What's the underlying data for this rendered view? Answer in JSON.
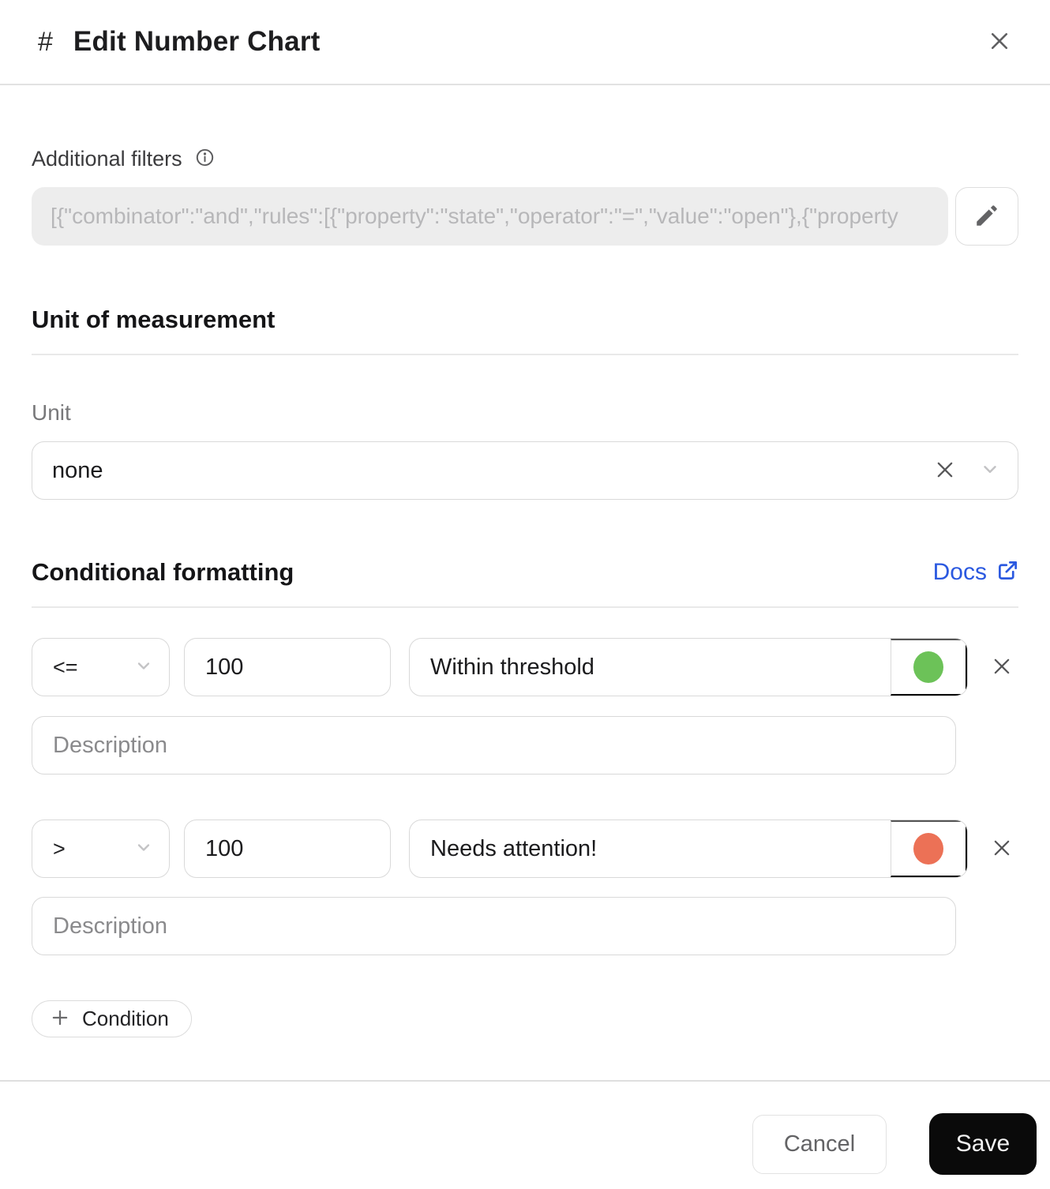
{
  "modal": {
    "title_prefix": "#",
    "title": "Edit Number Chart"
  },
  "filters": {
    "label": "Additional filters",
    "value": "[{\"combinator\":\"and\",\"rules\":[{\"property\":\"state\",\"operator\":\"=\",\"value\":\"open\"},{\"property"
  },
  "unit_section": {
    "heading": "Unit of measurement",
    "unit_label": "Unit",
    "unit_value": "none"
  },
  "conditional": {
    "heading": "Conditional formatting",
    "docs_label": "Docs",
    "conditions": [
      {
        "operator": "<=",
        "value": "100",
        "label": "Within threshold",
        "color": "#6cc258",
        "description_placeholder": "Description"
      },
      {
        "operator": ">",
        "value": "100",
        "label": "Needs attention!",
        "color": "#ec7156",
        "description_placeholder": "Description"
      }
    ],
    "add_button_label": "Condition"
  },
  "footer": {
    "cancel_label": "Cancel",
    "save_label": "Save"
  },
  "colors": {
    "accent_link": "#2b59e0",
    "status_green": "#6cc258",
    "status_orange": "#ec7156",
    "save_button_bg": "#0a0a0a"
  },
  "icons": {
    "header": [
      "hash-icon",
      "close-icon"
    ],
    "filters": [
      "info-icon",
      "pencil-icon"
    ],
    "unit": [
      "clear-icon",
      "chevron-down-icon"
    ],
    "conditional": [
      "external-link-icon",
      "chevron-down-icon",
      "remove-icon",
      "plus-icon"
    ]
  }
}
